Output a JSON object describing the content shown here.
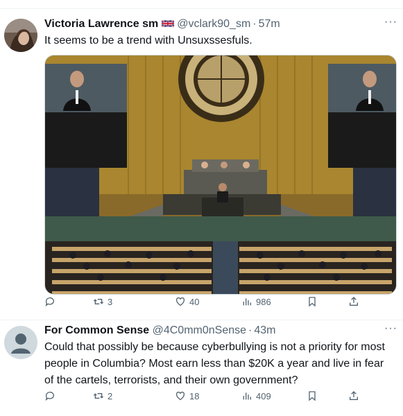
{
  "tweets": [
    {
      "name": "Victoria Lawrence sm",
      "handle": "@vclark90_sm",
      "time": "57m",
      "text": "It seems to be a trend with Unsuxssesfuls.",
      "counts": {
        "reply": "",
        "retweet": "3",
        "like": "40",
        "views": "986"
      }
    },
    {
      "name": "For Common Sense",
      "handle": "@4C0mm0nSense",
      "time": "43m",
      "text": "Could that possibly be because cyberbullying is not a priority for most people in Columbia? Most earn less than $20K a year and live in fear of the cartels, terrorists, and their own government?",
      "counts": {
        "reply": "",
        "retweet": "2",
        "like": "18",
        "views": "409"
      }
    }
  ],
  "separator": "·",
  "more_glyph": "···",
  "colors": {
    "text": "#0f1419",
    "muted": "#536471",
    "border": "#eff3f4"
  },
  "icons": [
    "reply-icon",
    "retweet-icon",
    "like-icon",
    "views-icon",
    "bookmark-icon",
    "share-icon",
    "more-icon"
  ]
}
